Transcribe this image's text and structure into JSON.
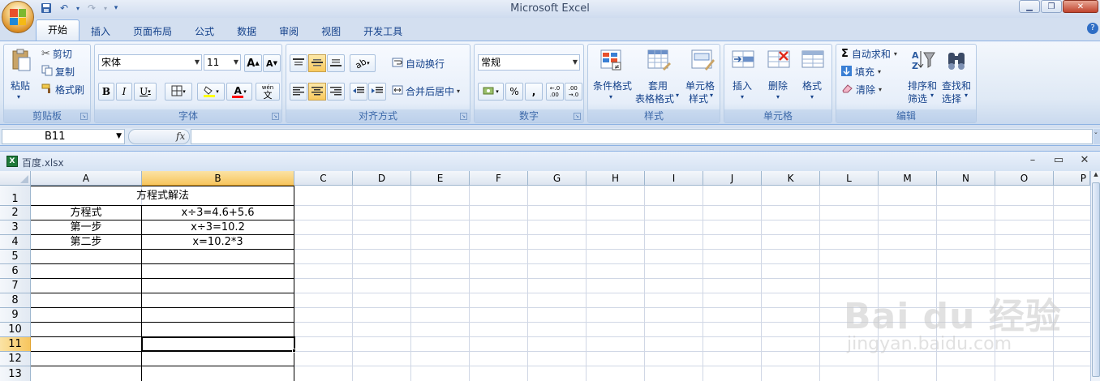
{
  "app": {
    "title": "Microsoft Excel",
    "help": "?"
  },
  "qat": {
    "undo": "↶",
    "redo": "↷"
  },
  "tabs": [
    "开始",
    "插入",
    "页面布局",
    "公式",
    "数据",
    "审阅",
    "视图",
    "开发工具"
  ],
  "ribbon": {
    "clipboard": {
      "label": "剪贴板",
      "paste": "粘贴",
      "cut": "剪切",
      "copy": "复制",
      "format_painter": "格式刷"
    },
    "font": {
      "label": "字体",
      "font_name": "宋体",
      "font_size": "11",
      "bold": "B",
      "italic": "I",
      "underline": "U",
      "grow": "A",
      "shrink": "A",
      "font_color": "A",
      "phonetic": "wén"
    },
    "alignment": {
      "label": "对齐方式",
      "wrap_text": "自动换行",
      "merge_center": "合并后居中"
    },
    "number": {
      "label": "数字",
      "format": "常规",
      "percent": "%",
      "comma": ",",
      "inc_decimal": "←.0\n.00",
      "dec_decimal": ".00\n→.0"
    },
    "styles": {
      "label": "样式",
      "conditional": [
        "条件格式"
      ],
      "table": [
        "套用",
        "表格格式"
      ],
      "cell_styles": [
        "单元格",
        "样式"
      ]
    },
    "cells": {
      "label": "单元格",
      "insert": "插入",
      "delete": "删除",
      "format": "格式"
    },
    "editing": {
      "label": "编辑",
      "autosum": "自动求和",
      "fill": "填充",
      "clear": "清除",
      "sort_filter": [
        "排序和",
        "筛选"
      ],
      "find_select": [
        "查找和",
        "选择"
      ]
    }
  },
  "formula_bar": {
    "name_box": "B11",
    "fx": "fx",
    "value": ""
  },
  "workbook": {
    "filename": "百度.xlsx",
    "columns": [
      "A",
      "B",
      "C",
      "D",
      "E",
      "F",
      "G",
      "H",
      "I",
      "J",
      "K",
      "L",
      "M",
      "N",
      "O",
      "P"
    ],
    "rows": [
      "1",
      "2",
      "3",
      "4",
      "5",
      "6",
      "7",
      "8",
      "9",
      "10",
      "11",
      "12",
      "13"
    ],
    "cells": {
      "title": "方程式解法",
      "a2": "方程式",
      "b2": "x÷3=4.6+5.6",
      "a3": "第一步",
      "b3": "x÷3=10.2",
      "a4": "第二步",
      "b4": "x=10.2*3"
    },
    "selected_cell": "B11"
  },
  "watermark": {
    "brand": "Bai du 经验",
    "url": "jingyan.baidu.com"
  }
}
